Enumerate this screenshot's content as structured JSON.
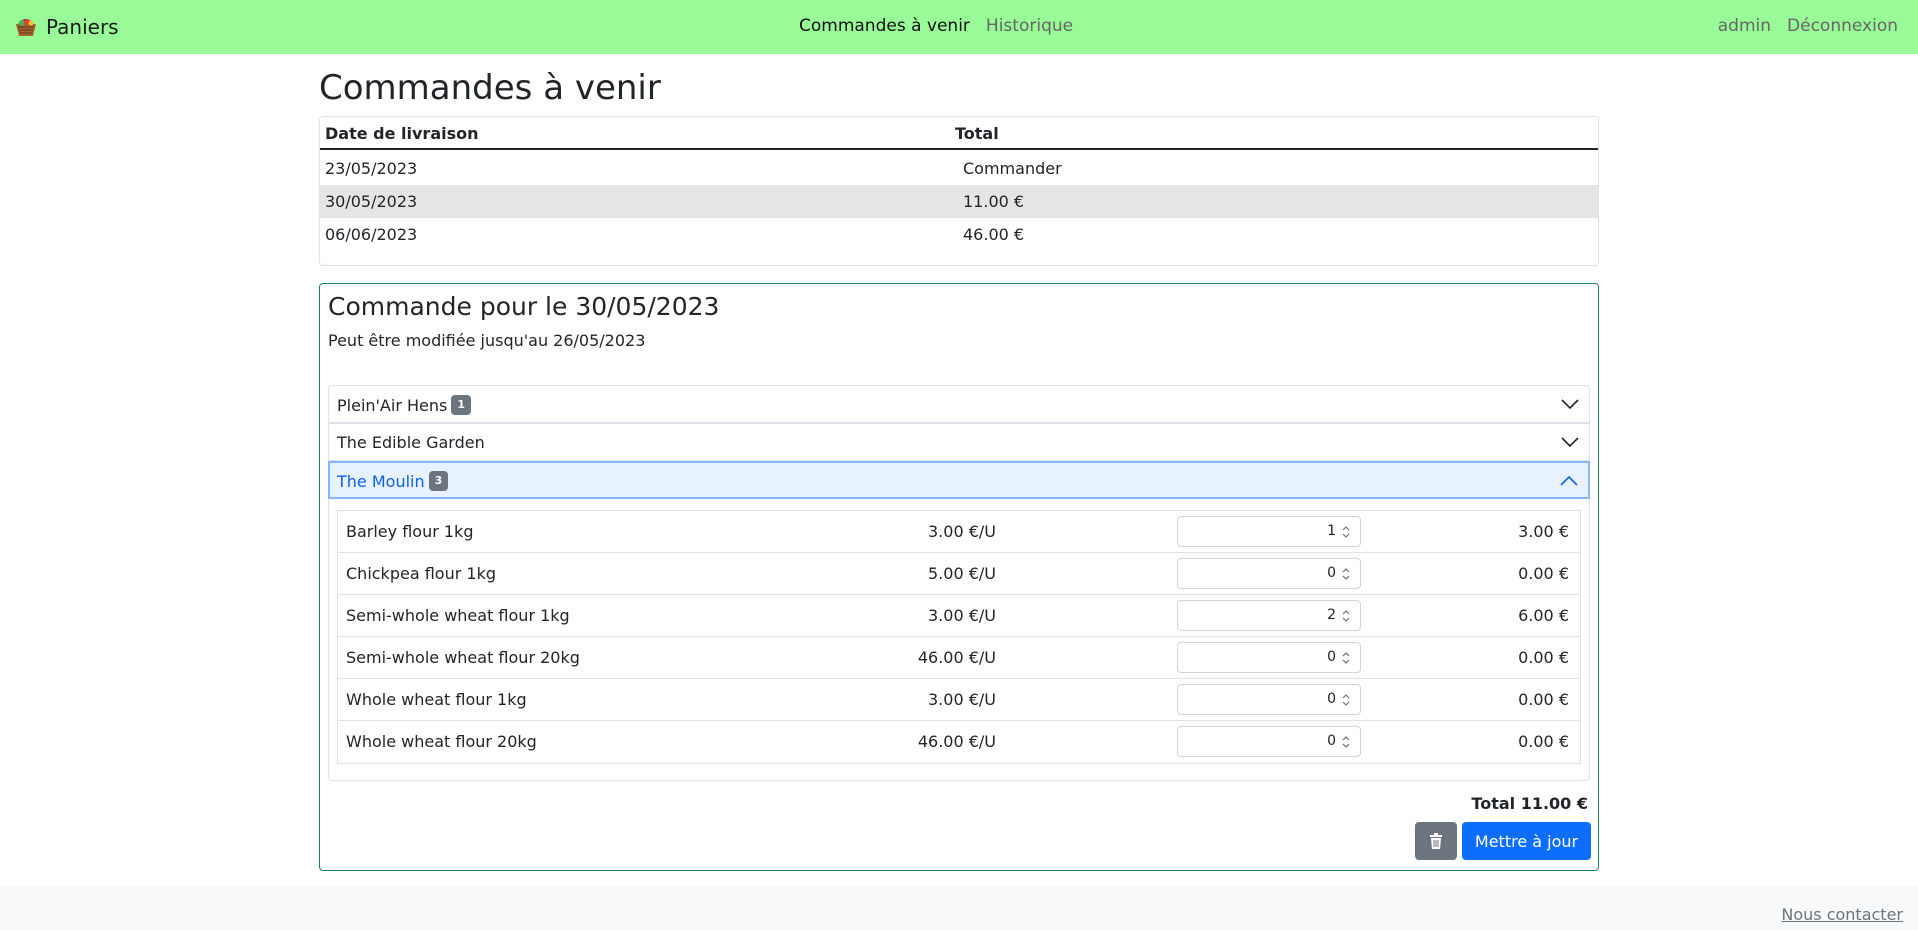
{
  "navbar": {
    "brand": "Paniers",
    "brand_icon": "basket-icon",
    "links": [
      "Commandes à venir",
      "Historique"
    ],
    "user": "admin",
    "logout": "Déconnexion",
    "bg_color": "#99fb98"
  },
  "page": {
    "title": "Commandes à venir"
  },
  "orders_table": {
    "headers": [
      "Date de livraison",
      "Total"
    ],
    "rows": [
      {
        "date": "23/05/2023",
        "total": "Commander"
      },
      {
        "date": "30/05/2023",
        "total": "11.00 €"
      },
      {
        "date": "06/06/2023",
        "total": "46.00 €"
      }
    ]
  },
  "order_detail": {
    "title": "Commande pour le 30/05/2023",
    "subtitle": "Peut être modifiée jusqu'au 26/05/2023",
    "accordion": [
      {
        "label": "Plein'Air Hens",
        "badge": "1",
        "expanded": false
      },
      {
        "label": "The Edible Garden",
        "badge": "",
        "expanded": false
      },
      {
        "label": "The Moulin",
        "badge": "3",
        "expanded": true
      }
    ],
    "products": [
      {
        "name": "Barley flour 1kg",
        "price": "3.00 €/U",
        "qty": "1",
        "total": "3.00 €"
      },
      {
        "name": "Chickpea flour 1kg",
        "price": "5.00 €/U",
        "qty": "0",
        "total": "0.00 €"
      },
      {
        "name": "Semi-whole wheat flour 1kg",
        "price": "3.00 €/U",
        "qty": "2",
        "total": "6.00 €"
      },
      {
        "name": "Semi-whole wheat flour 20kg",
        "price": "46.00 €/U",
        "qty": "0",
        "total": "0.00 €"
      },
      {
        "name": "Whole wheat flour 1kg",
        "price": "3.00 €/U",
        "qty": "0",
        "total": "0.00 €"
      },
      {
        "name": "Whole wheat flour 20kg",
        "price": "46.00 €/U",
        "qty": "0",
        "total": "0.00 €"
      }
    ],
    "total": "Total 11.00 €",
    "delete_icon": "trash-icon",
    "update_label": "Mettre à jour"
  },
  "footer": {
    "contact": "Nous contacter"
  }
}
